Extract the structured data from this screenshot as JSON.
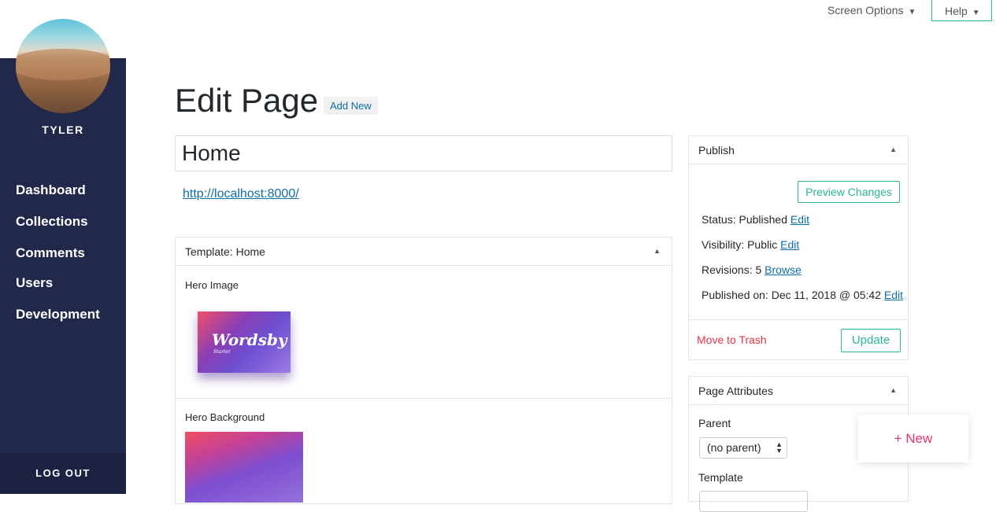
{
  "sidebar": {
    "username": "TYLER",
    "items": [
      {
        "label": "Dashboard"
      },
      {
        "label": "Collections"
      },
      {
        "label": "Comments"
      },
      {
        "label": "Users"
      },
      {
        "label": "Development"
      }
    ],
    "logout": "LOG OUT"
  },
  "topbar": {
    "screen_options": "Screen Options",
    "help": "Help"
  },
  "header": {
    "title": "Edit Page",
    "add_new": "Add New"
  },
  "editor": {
    "post_title": "Home",
    "permalink": "http://localhost:8000/"
  },
  "template_box": {
    "title": "Template: Home",
    "hero_image_label": "Hero Image",
    "hero_image_text": "Wordsby",
    "hero_image_subtext": "Starter",
    "hero_background_label": "Hero Background"
  },
  "publish": {
    "title": "Publish",
    "preview_button": "Preview Changes",
    "status_label": "Status:",
    "status_value": "Published",
    "visibility_label": "Visibility:",
    "visibility_value": "Public",
    "revisions_label": "Revisions:",
    "revisions_value": "5",
    "browse_link": "Browse",
    "published_label": "Published on:",
    "published_value": "Dec 11, 2018 @ 05:42",
    "edit_link": "Edit",
    "trash": "Move to Trash",
    "update_button": "Update"
  },
  "attributes": {
    "title": "Page Attributes",
    "parent_label": "Parent",
    "parent_value": "(no parent)",
    "template_label": "Template"
  },
  "fab": {
    "label": "+ New"
  },
  "colors": {
    "sidebar_bg": "#222849",
    "accent_green": "#2cb39a",
    "link_blue": "#0f6fa3",
    "danger_red": "#e8334a",
    "fab_pink": "#e8336a"
  }
}
